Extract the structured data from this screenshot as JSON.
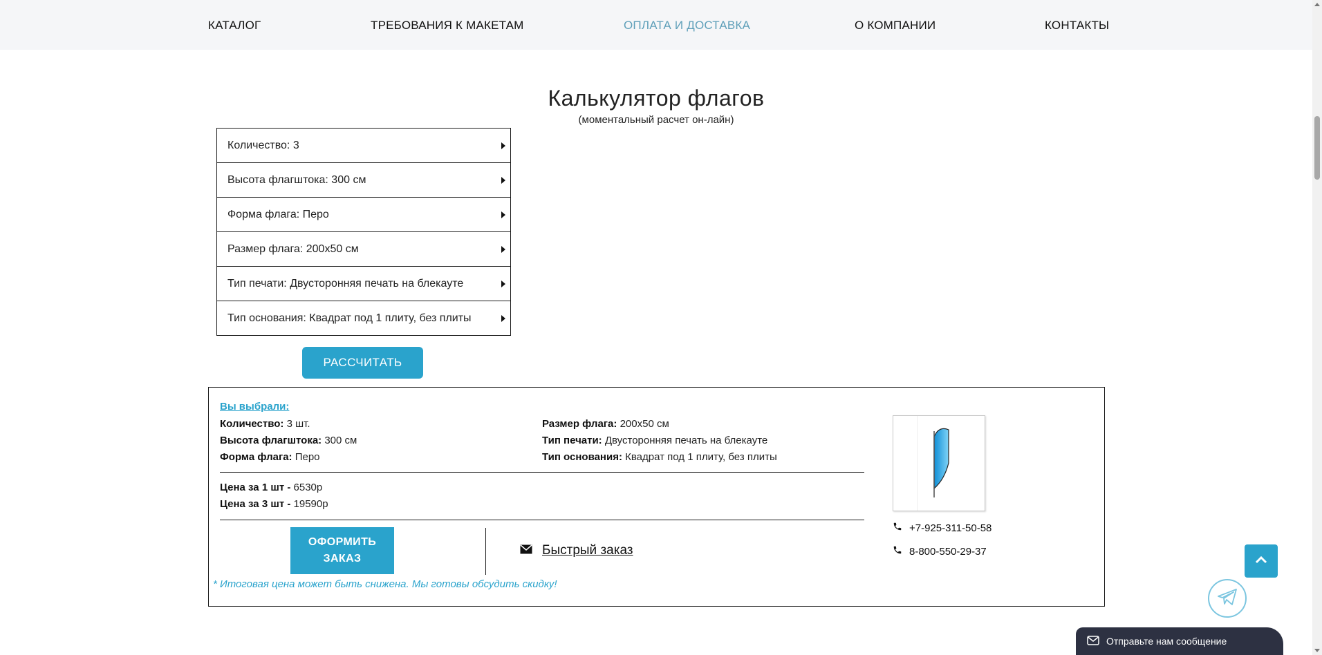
{
  "nav": {
    "items": [
      {
        "label": "КАТАЛОГ"
      },
      {
        "label": "ТРЕБОВАНИЯ К МАКЕТАМ"
      },
      {
        "label": "ОПЛАТА И ДОСТАВКА"
      },
      {
        "label": "О КОМПАНИИ"
      },
      {
        "label": "КОНТАКТЫ"
      }
    ],
    "active_color": "#5e9fb9"
  },
  "page": {
    "title": "Калькулятор флагов",
    "subtitle": "(моментальный расчет он-лайн)"
  },
  "calculator": {
    "options": [
      {
        "label": "Количество: 3"
      },
      {
        "label": "Высота флагштока: 300 см"
      },
      {
        "label": "Форма флага: Перо"
      },
      {
        "label": "Размер флага: 200x50 см"
      },
      {
        "label": "Тип печати: Двусторонняя печать на блекауте"
      },
      {
        "label": "Тип основания: Квадрат под 1 плиту, без плиты"
      }
    ],
    "calculate_label": "РАССЧИТАТЬ"
  },
  "summary": {
    "title": "Вы выбрали:",
    "fields": {
      "quantity": {
        "key": "Количество:",
        "value": "3 шт."
      },
      "pole_height": {
        "key": "Высота флагштока:",
        "value": "300 см"
      },
      "flag_shape": {
        "key": "Форма флага:",
        "value": "Перо"
      },
      "flag_size": {
        "key": "Размер флага:",
        "value": "200x50 см"
      },
      "print_type": {
        "key": "Тип печати:",
        "value": "Двусторонняя печать на блекауте"
      },
      "base_type": {
        "key": "Тип основания:",
        "value": "Квадрат под 1 плиту, без плиты"
      }
    },
    "price_one": {
      "key": "Цена за 1 шт -",
      "value": "6530р"
    },
    "price_total": {
      "key": "Цена за 3 шт -",
      "value": "19590р"
    },
    "order_label_line1": "ОФОРМИТЬ",
    "order_label_line2": "ЗАКАЗ",
    "quick_order_label": "Быстрый заказ",
    "note": "* Итоговая цена может быть снижена. Мы готовы обсудить скидку!",
    "phones": [
      "+7-925-311-50-58",
      "8-800-550-29-37"
    ]
  },
  "chat": {
    "label": "Отправьте нам сообщение"
  },
  "colors": {
    "accent": "#2aa3cc",
    "nav_bg": "#f5f6f8",
    "chat_bg": "#2d3142"
  },
  "icons": [
    "triangle-right-icon",
    "envelope-icon",
    "phone-icon",
    "chevron-up-icon",
    "telegram-icon",
    "mail-icon"
  ]
}
